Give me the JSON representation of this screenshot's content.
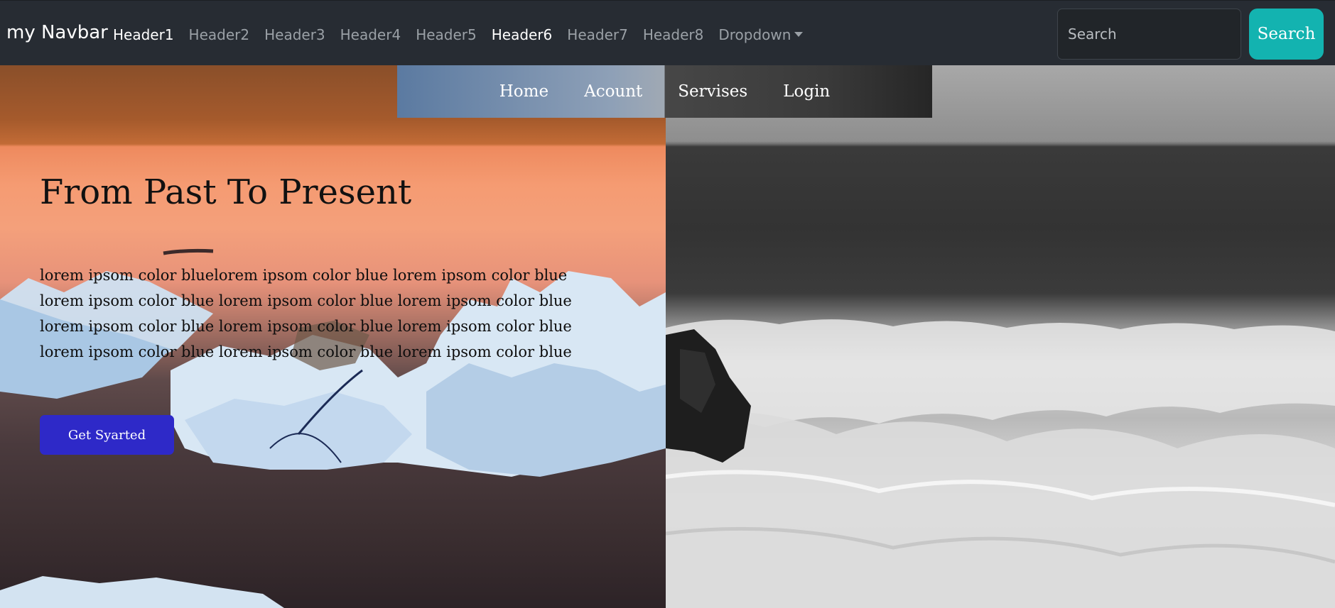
{
  "navbar": {
    "brand": "my Navbar",
    "links": [
      {
        "label": "Header1"
      },
      {
        "label": "Header2"
      },
      {
        "label": "Header3"
      },
      {
        "label": "Header4"
      },
      {
        "label": "Header5"
      },
      {
        "label": "Header6"
      },
      {
        "label": "Header7"
      },
      {
        "label": "Header8"
      },
      {
        "label": "Dropdown"
      }
    ],
    "search": {
      "placeholder": "Search",
      "value": ""
    },
    "search_button": "Search"
  },
  "submenu": {
    "items": [
      {
        "label": "Home"
      },
      {
        "label": "Acount"
      },
      {
        "label": "Servises"
      },
      {
        "label": "Login"
      }
    ]
  },
  "hero": {
    "title": "From Past To Present",
    "body": "lorem ipsom color bluelorem ipsom color blue lorem ipsom color blue lorem ipsom color blue lorem ipsom color blue lorem ipsom color blue lorem ipsom color blue lorem ipsom color blue lorem ipsom color blue lorem ipsom color blue lorem ipsom color blue lorem ipsom color blue",
    "cta": "Get Syarted"
  },
  "colors": {
    "navbar_bg": "#272c33",
    "search_button": "#13b3b0",
    "cta_button": "#2e29c8"
  }
}
